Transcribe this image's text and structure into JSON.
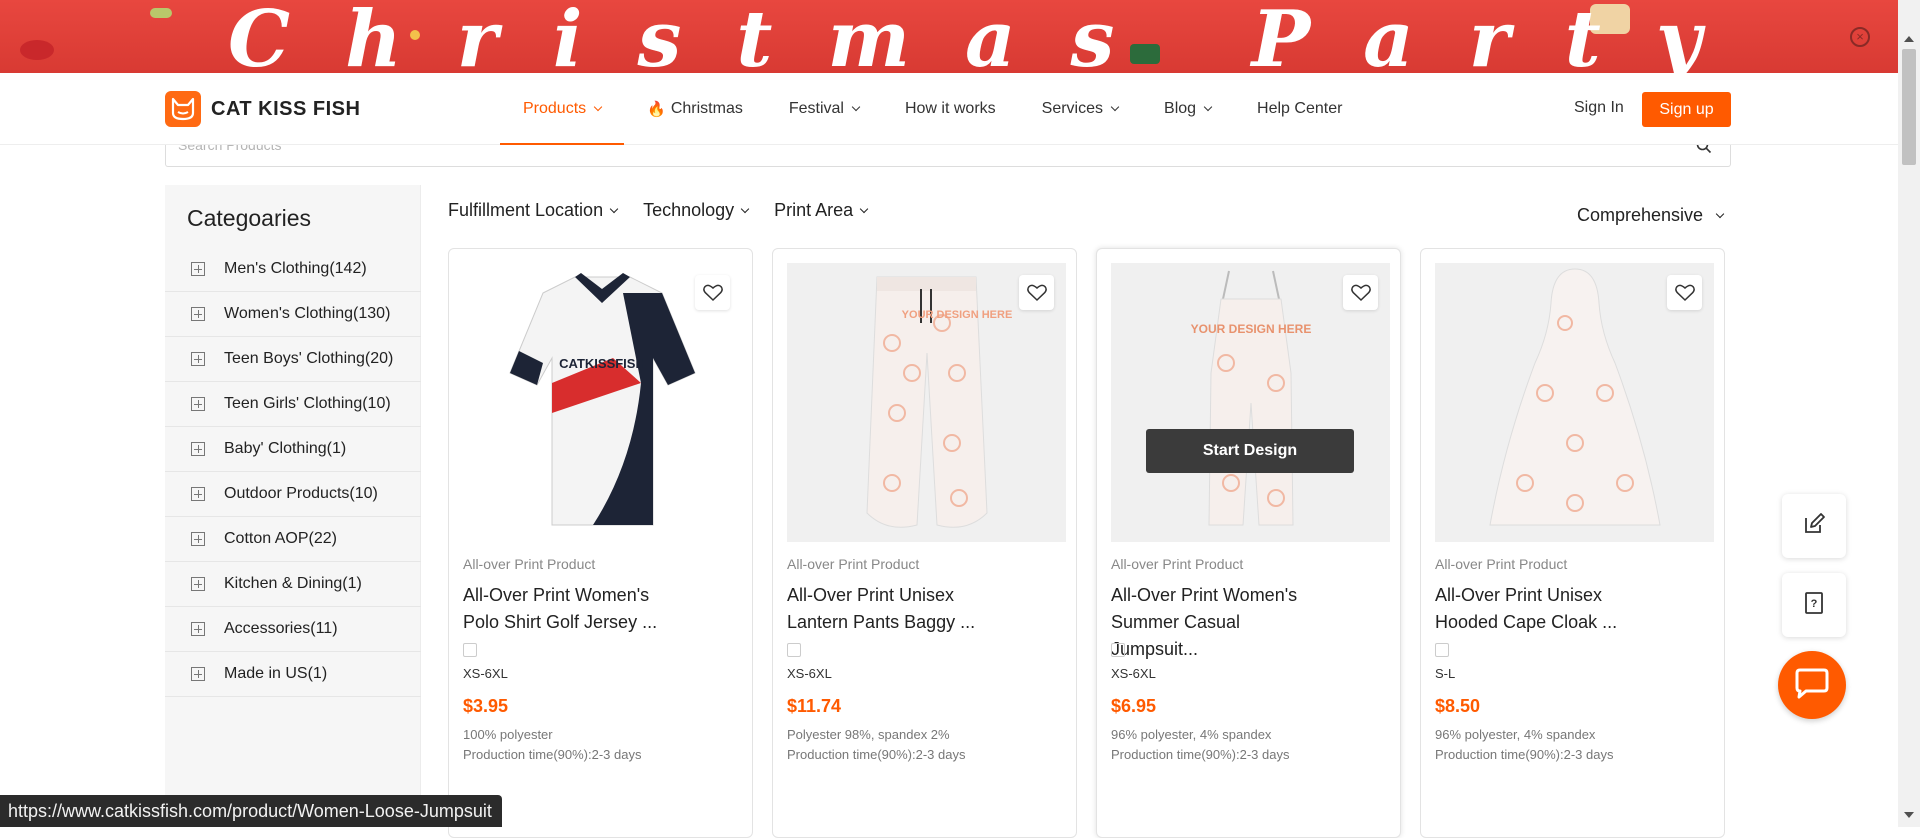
{
  "banner": {
    "text": "Christmas Party",
    "close_icon": "close-circle-icon"
  },
  "brand": {
    "name": "CAT KISS FISH",
    "accent": "#ff5a00"
  },
  "nav": {
    "items": [
      {
        "label": "Products",
        "dropdown": true,
        "active": true
      },
      {
        "label": "Christmas",
        "dropdown": false,
        "icon": "flame-icon"
      },
      {
        "label": "Festival",
        "dropdown": true
      },
      {
        "label": "How it works",
        "dropdown": false
      },
      {
        "label": "Services",
        "dropdown": true
      },
      {
        "label": "Blog",
        "dropdown": true
      },
      {
        "label": "Help Center",
        "dropdown": false
      }
    ],
    "sign_in": "Sign In",
    "sign_up": "Sign up"
  },
  "search": {
    "placeholder": "Search Products"
  },
  "sidebar": {
    "title": "Categoaries",
    "categories": [
      "Men's Clothing(142)",
      "Women's Clothing(130)",
      "Teen Boys' Clothing(20)",
      "Teen Girls' Clothing(10)",
      "Baby' Clothing(1)",
      "Outdoor Products(10)",
      "Cotton AOP(22)",
      "Kitchen & Dining(1)",
      "Accessories(11)",
      "Made in US(1)"
    ]
  },
  "filters": [
    "Fulfillment Location",
    "Technology",
    "Print Area"
  ],
  "sort": {
    "label": "Comprehensive"
  },
  "products": [
    {
      "category": "All-over Print Product",
      "title": "All-Over Print Women's Polo Shirt Golf Jersey ...",
      "sizes": "XS-6XL",
      "price": "$3.95",
      "material": "100% polyester",
      "production": "Production time(90%):2-3 days",
      "image_text": "CATKISSFISH"
    },
    {
      "category": "All-over Print Product",
      "title": "All-Over Print Unisex Lantern Pants Baggy ...",
      "sizes": "XS-6XL",
      "price": "$11.74",
      "material": "Polyester 98%, spandex 2%",
      "production": "Production time(90%):2-3 days",
      "image_text": "YOUR DESIGN HERE"
    },
    {
      "category": "All-over Print Product",
      "title": "All-Over Print Women's Summer Casual Jumpsuit...",
      "sizes": "XS-6XL",
      "price": "$6.95",
      "material": "96% polyester, 4% spandex",
      "production": "Production time(90%):2-3 days",
      "image_text": "YOUR DESIGN HERE",
      "hover_button": "Start Design"
    },
    {
      "category": "All-over Print Product",
      "title": "All-Over Print Unisex Hooded Cape Cloak ...",
      "sizes": "S-L",
      "price": "$8.50",
      "material": "96% polyester, 4% spandex",
      "production": "Production time(90%):2-3 days"
    }
  ],
  "floating": {
    "edit_icon": "edit-icon",
    "help_icon": "help-doc-icon",
    "chat_icon": "chat-icon"
  },
  "status_url": "https://www.catkissfish.com/product/Women-Loose-Jumpsuit"
}
